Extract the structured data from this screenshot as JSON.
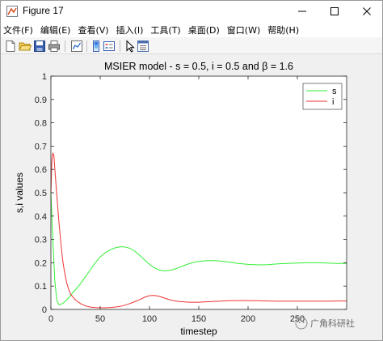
{
  "window": {
    "title": "Figure 17",
    "controls": [
      "minimize",
      "maximize",
      "close"
    ]
  },
  "menu": [
    "文件(F)",
    "编辑(E)",
    "查看(V)",
    "插入(I)",
    "工具(T)",
    "桌面(D)",
    "窗口(W)",
    "帮助(H)"
  ],
  "toolbar": [
    "new-figure-icon",
    "open-icon",
    "save-icon",
    "print-icon",
    "link-plot-icon",
    "insert-legend-icon",
    "edit-plot-icon",
    "property-inspector-icon"
  ],
  "watermark": "广角科研社",
  "colors": {
    "s": "#33ee33",
    "i": "#ee3333"
  },
  "chart_data": {
    "type": "line",
    "title": "MSIER model - s = 0.5, i = 0.5 and β = 1.6",
    "xlabel": "timestep",
    "ylabel": "s,i values",
    "xlim": [
      0,
      300
    ],
    "ylim": [
      0,
      1
    ],
    "xticks": [
      0,
      50,
      100,
      150,
      200,
      250
    ],
    "yticks": [
      0,
      0.1,
      0.2,
      0.3,
      0.4,
      0.5,
      0.6,
      0.7,
      0.8,
      0.9,
      1
    ],
    "grid": false,
    "legend": "top-right",
    "series": [
      {
        "name": "s",
        "color": "#33ee33",
        "x": [
          0,
          2,
          4,
          6,
          8,
          12,
          16,
          20,
          25,
          30,
          35,
          40,
          45,
          50,
          55,
          60,
          65,
          70,
          75,
          80,
          85,
          90,
          95,
          100,
          105,
          110,
          115,
          120,
          125,
          130,
          135,
          140,
          145,
          150,
          155,
          160,
          165,
          170,
          175,
          180,
          185,
          190,
          200,
          210,
          220,
          230,
          240,
          250,
          260,
          270,
          280,
          290,
          300
        ],
        "y": [
          0.5,
          0.3,
          0.12,
          0.04,
          0.02,
          0.025,
          0.04,
          0.06,
          0.085,
          0.11,
          0.14,
          0.17,
          0.2,
          0.225,
          0.243,
          0.255,
          0.264,
          0.268,
          0.268,
          0.262,
          0.25,
          0.232,
          0.212,
          0.193,
          0.178,
          0.169,
          0.165,
          0.167,
          0.172,
          0.18,
          0.188,
          0.196,
          0.202,
          0.206,
          0.208,
          0.209,
          0.209,
          0.208,
          0.206,
          0.203,
          0.2,
          0.197,
          0.193,
          0.191,
          0.192,
          0.195,
          0.197,
          0.199,
          0.2,
          0.2,
          0.199,
          0.197,
          0.197
        ]
      },
      {
        "name": "i",
        "color": "#ee3333",
        "x": [
          0,
          1,
          2,
          3,
          4,
          6,
          8,
          10,
          12,
          14,
          16,
          18,
          20,
          25,
          30,
          35,
          40,
          45,
          50,
          55,
          60,
          65,
          70,
          75,
          80,
          85,
          90,
          95,
          100,
          105,
          110,
          115,
          120,
          125,
          130,
          140,
          150,
          160,
          170,
          180,
          190,
          200,
          210,
          220,
          230,
          240,
          250,
          260,
          270,
          280,
          290,
          300
        ],
        "y": [
          0.5,
          0.64,
          0.67,
          0.66,
          0.6,
          0.49,
          0.38,
          0.29,
          0.21,
          0.155,
          0.115,
          0.085,
          0.065,
          0.04,
          0.025,
          0.015,
          0.01,
          0.008,
          0.007,
          0.007,
          0.008,
          0.01,
          0.013,
          0.018,
          0.025,
          0.033,
          0.042,
          0.052,
          0.059,
          0.06,
          0.056,
          0.049,
          0.042,
          0.037,
          0.034,
          0.031,
          0.031,
          0.033,
          0.035,
          0.037,
          0.038,
          0.038,
          0.037,
          0.036,
          0.035,
          0.035,
          0.035,
          0.035,
          0.035,
          0.035,
          0.036,
          0.036
        ]
      }
    ]
  }
}
